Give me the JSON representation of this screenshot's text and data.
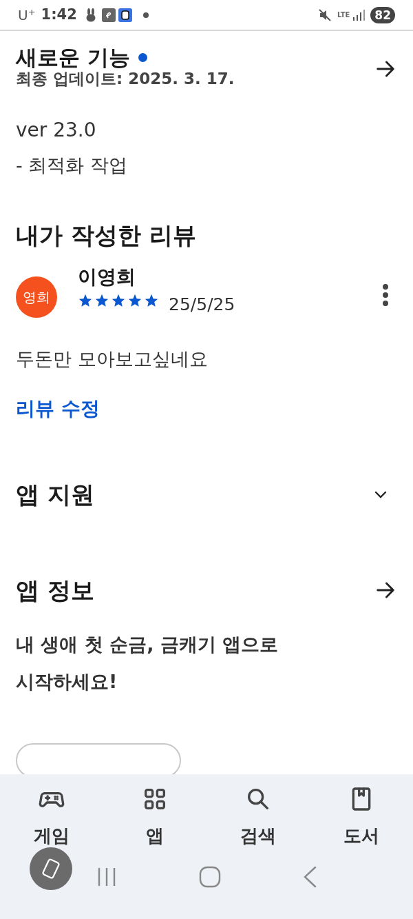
{
  "status_bar": {
    "carrier": "U",
    "carrier_mark": "+",
    "time": "1:42",
    "network": "LTE",
    "battery": "82"
  },
  "whats_new": {
    "title": "새로운 기능",
    "new_dot": true,
    "updated": "최종 업데이트: 2025. 3. 17.",
    "version": "ver 23.0",
    "notes": "- 최적화 작업"
  },
  "my_review": {
    "heading": "내가 작성한 리뷰",
    "avatar": "영희",
    "author": "이영희",
    "stars": 5,
    "date": "25/5/25",
    "text": "두돈만 모아보고싶네요",
    "edit_link": "리뷰 수정"
  },
  "app_support": {
    "title": "앱 지원",
    "expanded": false
  },
  "app_info": {
    "title": "앱 정보",
    "description": "내 생애 첫 순금, 금캐기 앱으로 시작하세요!"
  },
  "bottom_nav": [
    {
      "label": "게임",
      "kind": "game",
      "selected": false
    },
    {
      "label": "앱",
      "kind": "apps",
      "selected": false
    },
    {
      "label": "검색",
      "kind": "search",
      "selected": false
    },
    {
      "label": "도서",
      "kind": "books",
      "selected": false
    }
  ]
}
